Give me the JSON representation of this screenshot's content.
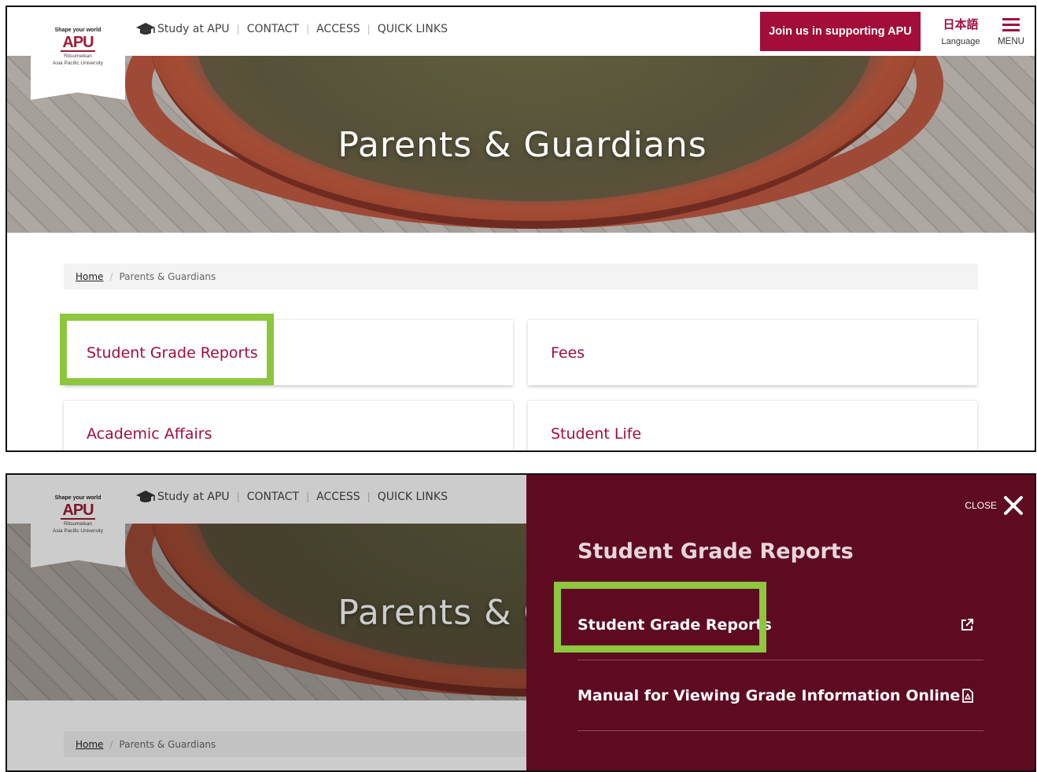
{
  "header": {
    "logo": {
      "tagline": "Shape your world",
      "mark": "APU",
      "sub_line1": "Ritsumeikan",
      "sub_line2": "Asia Pacific University"
    },
    "nav": [
      "Study at APU",
      "CONTACT",
      "ACCESS",
      "QUICK LINKS"
    ],
    "support_button": "Join us in supporting APU",
    "language": {
      "native": "日本語",
      "label": "Language"
    },
    "menu_label": "MENU"
  },
  "hero": {
    "title": "Parents & Guardians"
  },
  "breadcrumb": {
    "home": "Home",
    "separator": "/",
    "current": "Parents & Guardians"
  },
  "cards": [
    "Student Grade Reports",
    "Fees",
    "Academic Affairs",
    "Student Life"
  ],
  "side_menu": {
    "close_label": "CLOSE",
    "title": "Student Grade Reports",
    "items": [
      {
        "label": "Student Grade Reports",
        "icon": "external-link-icon"
      },
      {
        "label": "Manual for Viewing Grade Information Online",
        "icon": "pdf-icon"
      }
    ]
  },
  "colors": {
    "brand": "#a20d3a",
    "highlight": "#8dc63f",
    "menu_bg": "#5e0b22"
  }
}
